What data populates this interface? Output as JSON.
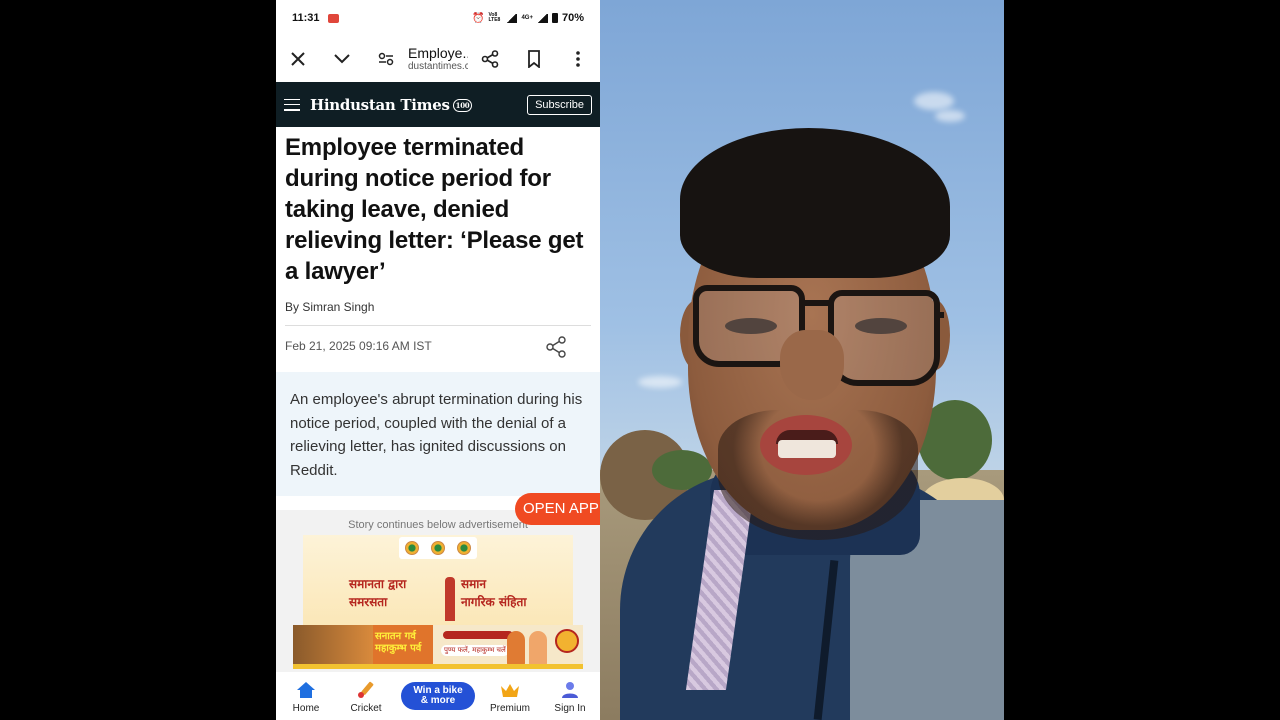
{
  "status_bar": {
    "time": "11:31",
    "volte_label": "Vo8 LTE8",
    "network_label": "4G+",
    "battery_percent": "70%"
  },
  "browser_toolbar": {
    "page_title": "Employe...",
    "domain": "dustantimes.com"
  },
  "site_header": {
    "logo_text": "Hindustan Times",
    "logo_badge": "100",
    "subscribe_label": "Subscribe"
  },
  "article": {
    "headline": "Employee terminated during notice period for taking leave, denied relieving letter: ‘Please get a lawyer’",
    "byline": "By Simran Singh",
    "date": "Feb 21, 2025 09:16 AM IST",
    "summary": "An employee's abrupt termination during his notice period, coupled with the denial of a relieving letter, has ignited discussions on Reddit."
  },
  "advertisement": {
    "label": "Story continues below advertisement",
    "banner_line1_left": "समानता द्वारा",
    "banner_line2_left": "समरसता",
    "banner_line1_right": "समान",
    "banner_line2_right": "नागरिक संहिता",
    "bottom_banner_text1": "सनातन गर्व",
    "bottom_banner_text2": "महाकुम्भ पर्व",
    "bottom_banner_tagline": "पुण्य फलें, महाकुम्भ चलें"
  },
  "open_app_label": "OPEN APP",
  "bottom_nav": {
    "items": [
      {
        "label": "Home",
        "icon": "home-icon"
      },
      {
        "label": "Cricket",
        "icon": "cricket-icon"
      },
      {
        "label": "Win a bike & more",
        "icon": "promo-button"
      },
      {
        "label": "Premium",
        "icon": "crown-icon"
      },
      {
        "label": "Sign In",
        "icon": "user-icon"
      }
    ],
    "promo_line1": "Win a bike",
    "promo_line2": "& more"
  },
  "colors": {
    "header_bg": "#0f1e24",
    "open_app_bg": "#f04a22",
    "promo_button_bg": "#2451d6",
    "summary_bg": "#eef5fa"
  }
}
